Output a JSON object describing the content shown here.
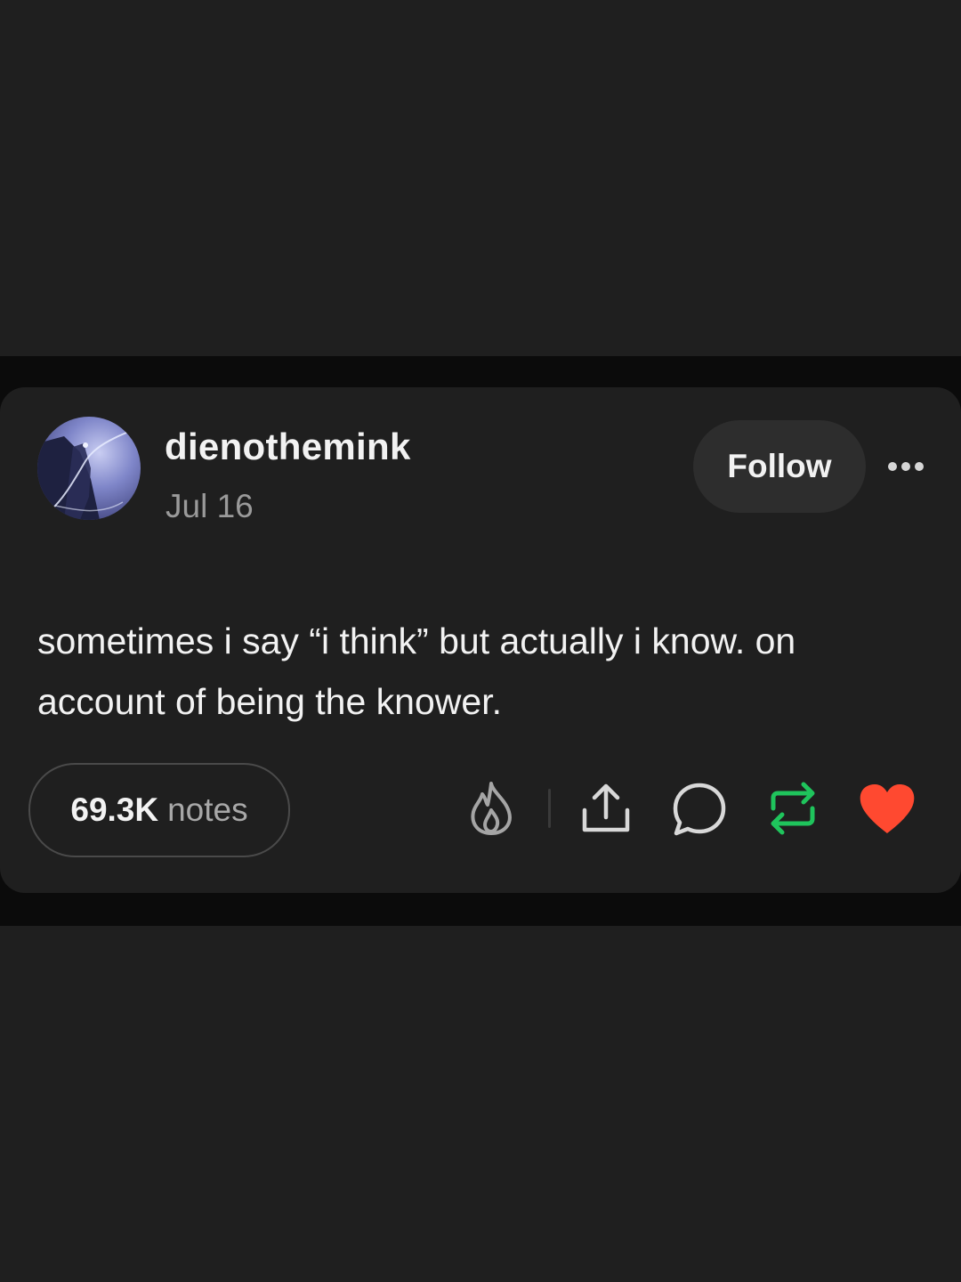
{
  "post": {
    "username": "dienothemink",
    "date": "Jul 16",
    "follow_label": "Follow",
    "avatar_icon": "mountain-climber-avatar",
    "body_text": "sometimes i say “i think” but actually i know. on account of being the knower."
  },
  "footer": {
    "notes_count": "69.3K",
    "notes_label": "notes",
    "actions": {
      "blaze_icon": "flame-icon",
      "share_icon": "share-icon",
      "reply_icon": "comment-icon",
      "reblog_icon": "reblog-icon",
      "like_icon": "heart-icon"
    }
  },
  "colors": {
    "background": "#1f1f1f",
    "band": "#0b0b0b",
    "text_primary": "#f2f2f2",
    "text_secondary": "#9a9a9a",
    "reblog_green": "#1fc45c",
    "like_red": "#ff4930",
    "follow_button_bg": "#2d2d2d"
  }
}
